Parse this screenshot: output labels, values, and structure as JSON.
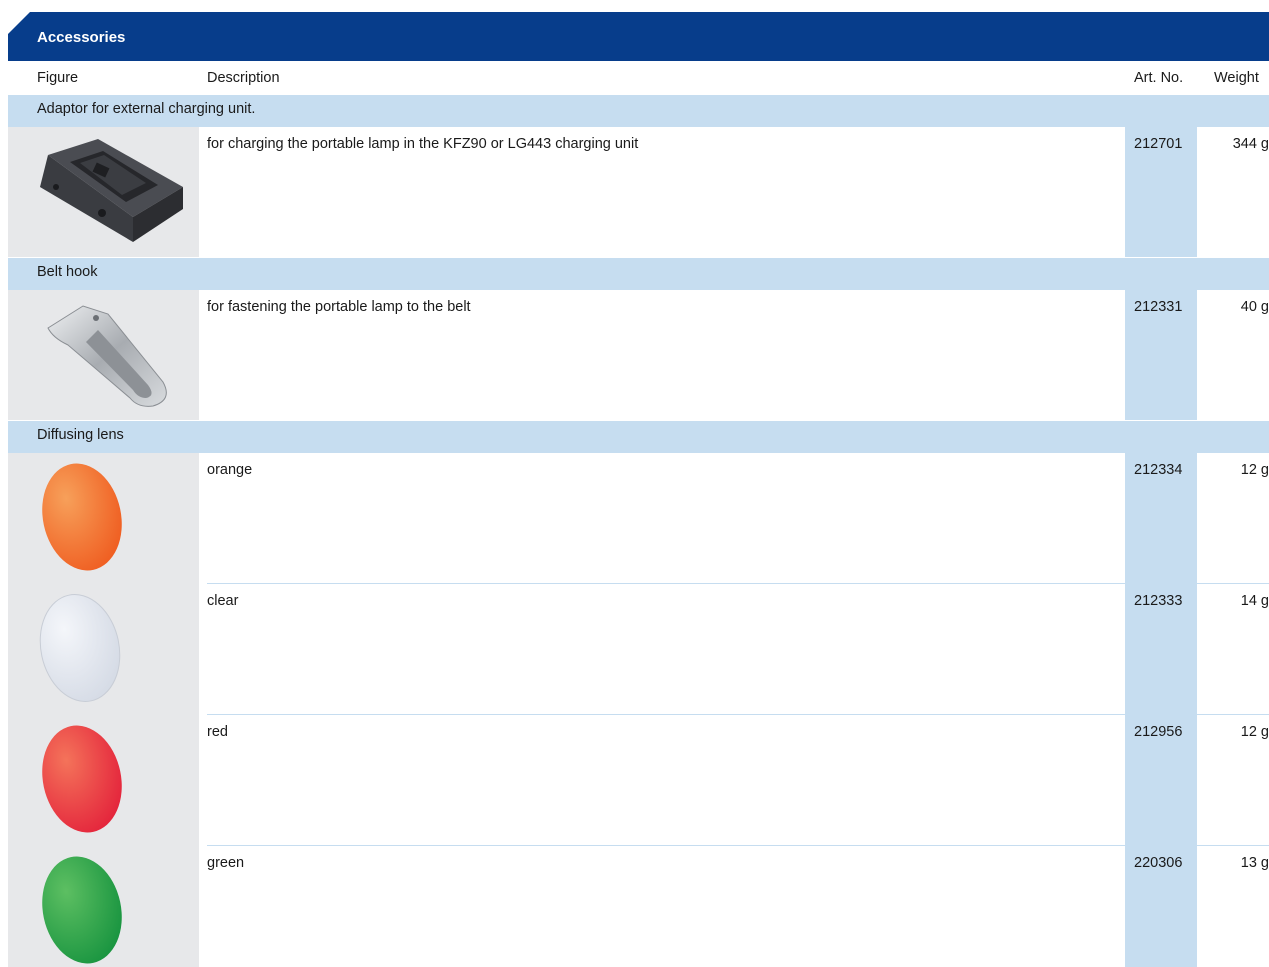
{
  "section": {
    "title": "Accessories"
  },
  "columns": {
    "figure": "Figure",
    "description": "Description",
    "art_no": "Art. No.",
    "weight": "Weight"
  },
  "groups": [
    {
      "title": "Adaptor for external charging unit.",
      "items": [
        {
          "image": "charging-adaptor-image",
          "description": "for charging the portable lamp in the KFZ90 or LG443 charging unit",
          "art_no": "212701",
          "weight": "344 g"
        }
      ]
    },
    {
      "title": "Belt hook",
      "items": [
        {
          "image": "belt-hook-image",
          "description": "for fastening the portable lamp to the belt",
          "art_no": "212331",
          "weight": "40 g"
        }
      ]
    },
    {
      "title": "Diffusing lens",
      "items": [
        {
          "image": "orange-lens-image",
          "color": "#f26a22",
          "description": "orange",
          "art_no": "212334",
          "weight": "12 g"
        },
        {
          "image": "clear-lens-image",
          "color": "#dde3ee",
          "description": "clear",
          "art_no": "212333",
          "weight": "14 g"
        },
        {
          "image": "red-lens-image",
          "color": "#e8283a",
          "description": "red",
          "art_no": "212956",
          "weight": "12 g"
        },
        {
          "image": "green-lens-image",
          "color": "#1f9a44",
          "description": "green",
          "art_no": "220306",
          "weight": "13 g"
        }
      ]
    }
  ]
}
